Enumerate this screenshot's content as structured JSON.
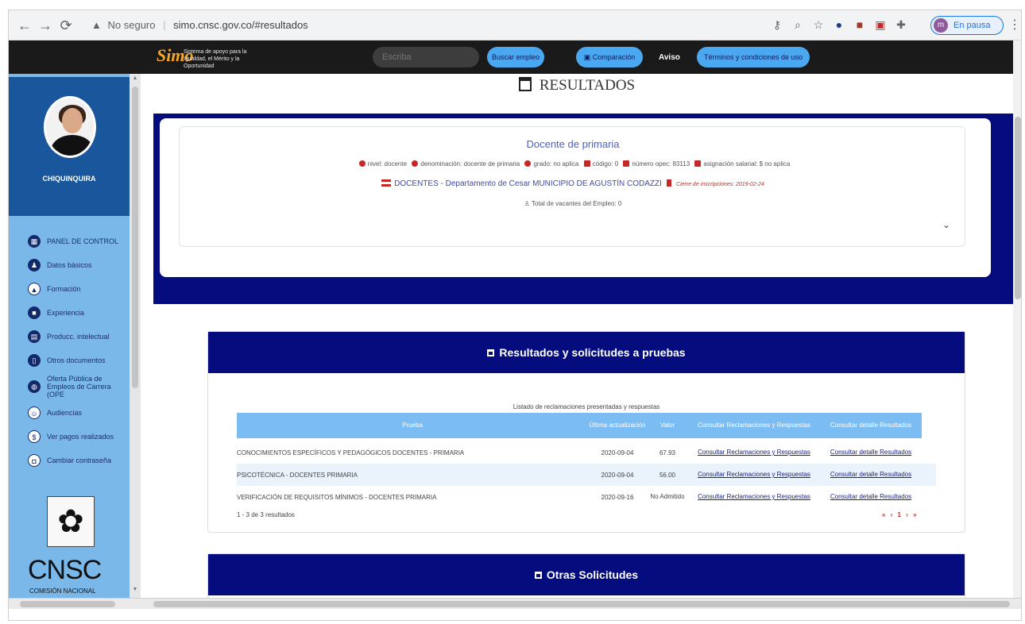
{
  "browser": {
    "insecure_label": "No seguro",
    "url": "simo.cnsc.gov.co/#resultados",
    "profile_initial": "m",
    "paused_label": "En pausa"
  },
  "topnav": {
    "logo_text": "Simo",
    "logo_tagline": "Sistema de apoyo para la Igualdad, el Mérito y la Oportunidad",
    "search_placeholder": "Escriba",
    "buscar_empleo": "Buscar empleo",
    "comparacion": "Comparación",
    "aviso": "Aviso",
    "terminos": "Términos y condiciones de uso"
  },
  "sidebar": {
    "user_name": "CHIQUINQUIRA",
    "items": [
      {
        "label": "PANEL DE CONTROL",
        "icon": "dashboard-icon"
      },
      {
        "label": "Datos básicos",
        "icon": "users-icon"
      },
      {
        "label": "Formación",
        "icon": "graduation-icon"
      },
      {
        "label": "Experiencia",
        "icon": "briefcase-icon"
      },
      {
        "label": "Producc. intelectual",
        "icon": "book-icon"
      },
      {
        "label": "Otros documentos",
        "icon": "document-icon"
      },
      {
        "label": "Oferta Pública de Empleos de Carrera (OPE",
        "icon": "globe-icon"
      },
      {
        "label": "Audiencias",
        "icon": "audience-icon"
      },
      {
        "label": "Ver pagos realizados",
        "icon": "dollar-icon"
      },
      {
        "label": "Cambiar contraseña",
        "icon": "lock-icon"
      }
    ],
    "brand_text": "CNSC",
    "brand_sub": "COMISIÓN NACIONAL"
  },
  "main": {
    "title": "RESULTADOS",
    "job": {
      "title": "Docente de primaria",
      "nivel": "nivel: docente",
      "denominacion": "denominación: docente de primaria",
      "grado": "grado: no aplica",
      "codigo": "código: 0",
      "numero_opec": "número opec: 83113",
      "asignacion": "asignación salarial: $ no aplica",
      "location": "DOCENTES - Departamento de Cesar MUNICIPIO DE AGUSTÍN CODAZZI",
      "cierre": "Cierre de inscripciones: 2019-02-24",
      "vacantes": "Total de vacantes del Empleo: 0"
    },
    "results": {
      "heading": "Resultados y solicitudes a pruebas",
      "caption": "Listado de reclamaciones presentadas y respuestas",
      "headers": [
        "Prueba",
        "Última actualización",
        "Valor",
        "Consultar Reclamaciones y Respuestas",
        "Consultar detalle Resultados"
      ],
      "rows": [
        {
          "prueba": "CONOCIMIENTOS ESPECÍFICOS Y PEDAGÓGICOS DOCENTES - PRIMARIA",
          "fecha": "2020-09-04",
          "valor": "67.93",
          "reclamaciones": "Consultar Reclamaciones y Respuestas",
          "detalle": "Consultar detalle Resultados"
        },
        {
          "prueba": "PSICOTÉCNICA - DOCENTES PRIMARIA",
          "fecha": "2020-09-04",
          "valor": "56.00",
          "reclamaciones": "Consultar Reclamaciones y Respuestas",
          "detalle": "Consultar detalle Resultados"
        },
        {
          "prueba": "VERIFICACIÓN DE REQUISITOS MÍNIMOS - DOCENTES PRIMARIA",
          "fecha": "2020-09-16",
          "valor": "No Admitido",
          "reclamaciones": "Consultar Reclamaciones y Respuestas",
          "detalle": "Consultar detalle Resultados"
        }
      ],
      "count": "1 - 3 de 3 resultados",
      "pager": "« ‹ 1 › »"
    },
    "otras": {
      "heading": "Otras Solicitudes"
    }
  },
  "colors": {
    "navy": "#050c7e",
    "sidebar": "#7bb8ea",
    "table_header": "#7bbcf3",
    "accent_red": "#c62828",
    "pill_blue": "#4aa8f0"
  }
}
